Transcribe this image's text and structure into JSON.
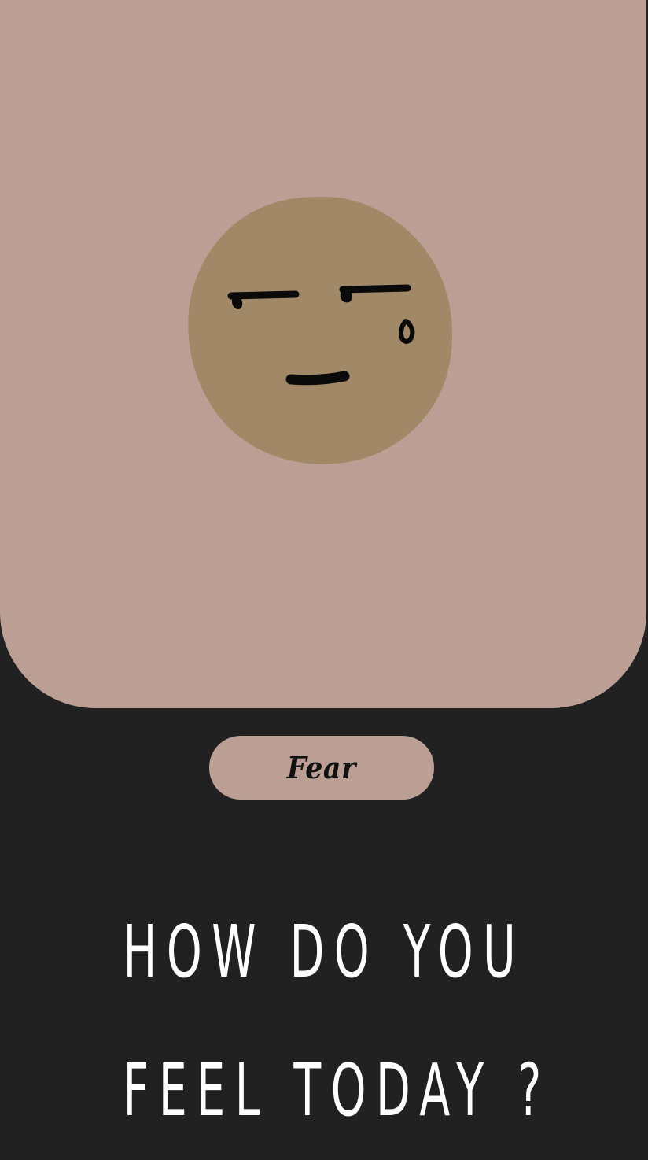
{
  "emotion": {
    "label": "Fear",
    "face_icon": "fear-face-icon",
    "card_color": "#bb9f94",
    "face_color": "#a18867"
  },
  "prompt": {
    "line1": "HOW DO YOU",
    "line2": "FEEL TODAY ?"
  },
  "colors": {
    "background": "#212121",
    "text": "#ffffff"
  }
}
